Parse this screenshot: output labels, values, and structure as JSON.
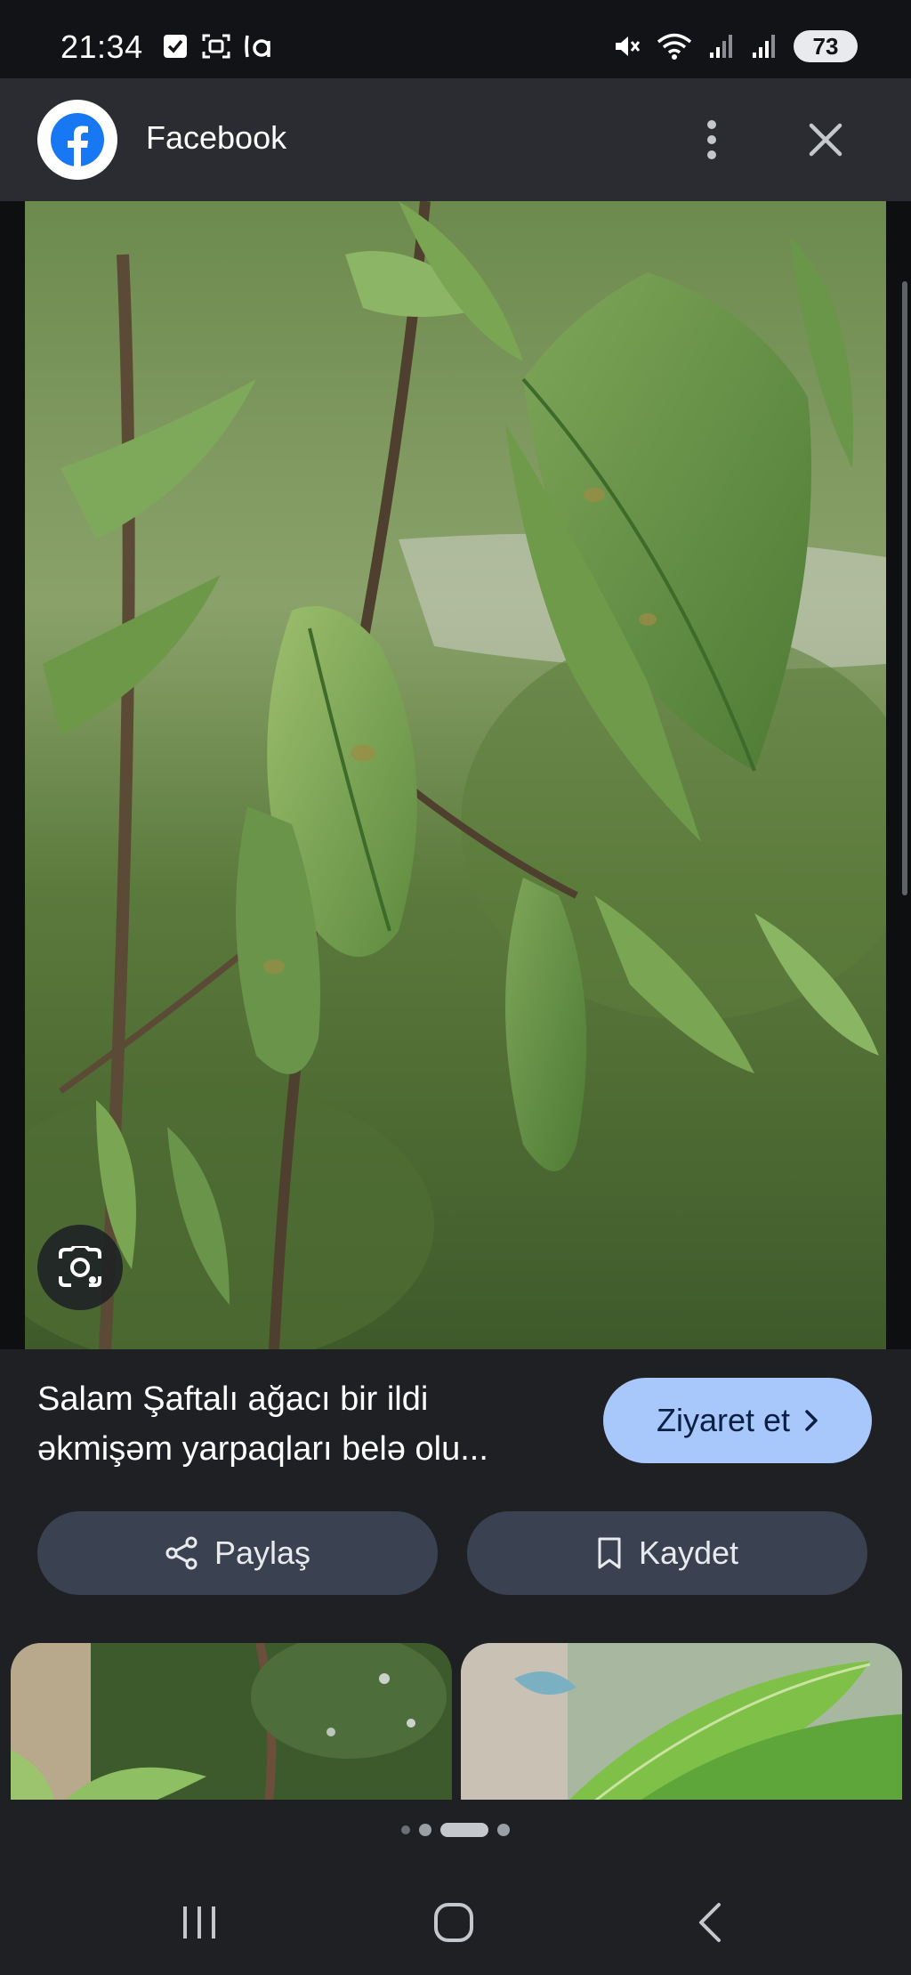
{
  "status_bar": {
    "time": "21:34",
    "battery": "73",
    "left_icons": [
      "checkbox-notification-icon",
      "screenshot-icon",
      "app-notification-icon"
    ],
    "right_icons": [
      "mute-icon",
      "wifi-icon",
      "signal-icon",
      "signal-icon"
    ]
  },
  "header": {
    "title": "Facebook",
    "brand_color": "#1877F2"
  },
  "result": {
    "caption_line1": "Salam Şaftalı ağacı bir ildi",
    "caption_line2": "əkmişəm yarpaqları belə olu...",
    "visit_label": "Ziyaret et",
    "share_label": "Paylaş",
    "save_label": "Kaydet"
  },
  "pager": {
    "count": 4,
    "active_index": 2
  },
  "colors": {
    "visit_button": "#A8C7FA",
    "action_button": "#3A4150",
    "background": "#1F2023"
  }
}
